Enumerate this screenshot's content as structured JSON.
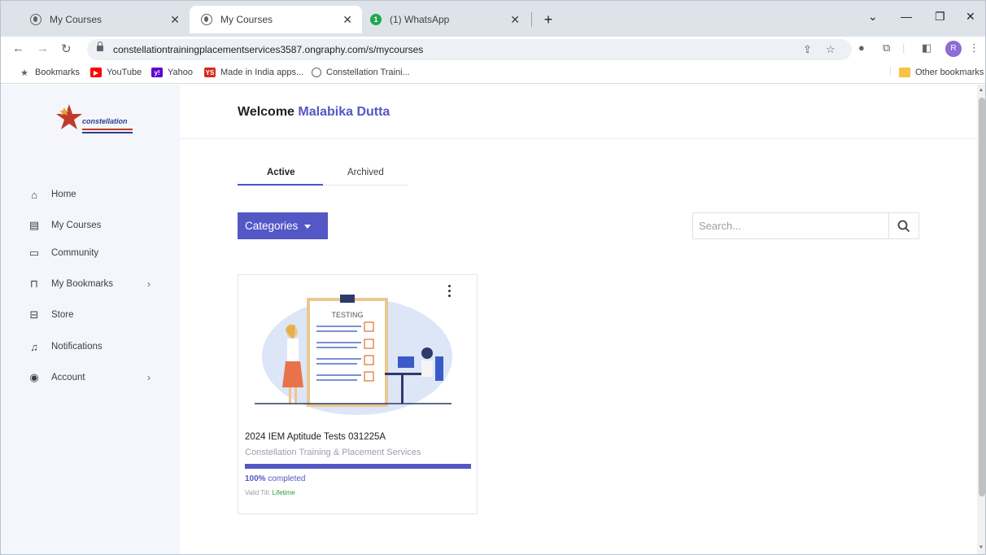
{
  "browser": {
    "tabs": [
      {
        "title": "My Courses",
        "favicon": "globe-icon",
        "active": false
      },
      {
        "title": "My Courses",
        "favicon": "globe-icon",
        "active": true
      },
      {
        "title": "(1) WhatsApp",
        "favicon": "whatsapp-icon",
        "badge": "1",
        "active": false
      }
    ],
    "url": "constellationtrainingplacementservices3587.ongraphy.com/s/mycourses",
    "profile_initial": "R",
    "bookmarks": [
      {
        "label": "Bookmarks",
        "icon": "star-icon"
      },
      {
        "label": "YouTube",
        "icon": "youtube-icon"
      },
      {
        "label": "Yahoo",
        "icon": "yahoo-icon",
        "glyph": "y!"
      },
      {
        "label": "Made in India apps...",
        "icon": "ys-icon",
        "glyph": "YS"
      },
      {
        "label": "Constellation Traini...",
        "icon": "globe-icon"
      }
    ],
    "other_bookmarks": "Other bookmarks"
  },
  "sidebar": {
    "items": [
      {
        "label": "Home",
        "icon": "home-icon",
        "has_chevron": false
      },
      {
        "label": "My Courses",
        "icon": "courses-icon",
        "has_chevron": false
      },
      {
        "label": "Community",
        "icon": "community-icon",
        "has_chevron": false
      },
      {
        "label": "My Bookmarks",
        "icon": "bookmark-icon",
        "has_chevron": true
      },
      {
        "label": "Store",
        "icon": "store-icon",
        "has_chevron": false
      },
      {
        "label": "Notifications",
        "icon": "bell-icon",
        "has_chevron": false
      },
      {
        "label": "Account",
        "icon": "account-icon",
        "has_chevron": true
      }
    ],
    "logo_text": "constellation"
  },
  "main": {
    "welcome_prefix": "Welcome",
    "user_name": "Malabika Dutta",
    "tabs": [
      {
        "label": "Active",
        "active": true
      },
      {
        "label": "Archived",
        "active": false
      }
    ],
    "categories_label": "Categories",
    "search_placeholder": "Search...",
    "course": {
      "image_label": "TESTING",
      "title": "2024 IEM Aptitude Tests 031225A",
      "provider": "Constellation Training & Placement Services",
      "progress_percent": 100,
      "progress_value": "100%",
      "progress_suffix": "completed",
      "valid_prefix": "Valid Till:",
      "valid_value": "Lifetime"
    }
  },
  "colors": {
    "accent": "#5457c6",
    "sidebar_bg": "#f4f6fb",
    "valid_green": "#1e9e3c"
  }
}
